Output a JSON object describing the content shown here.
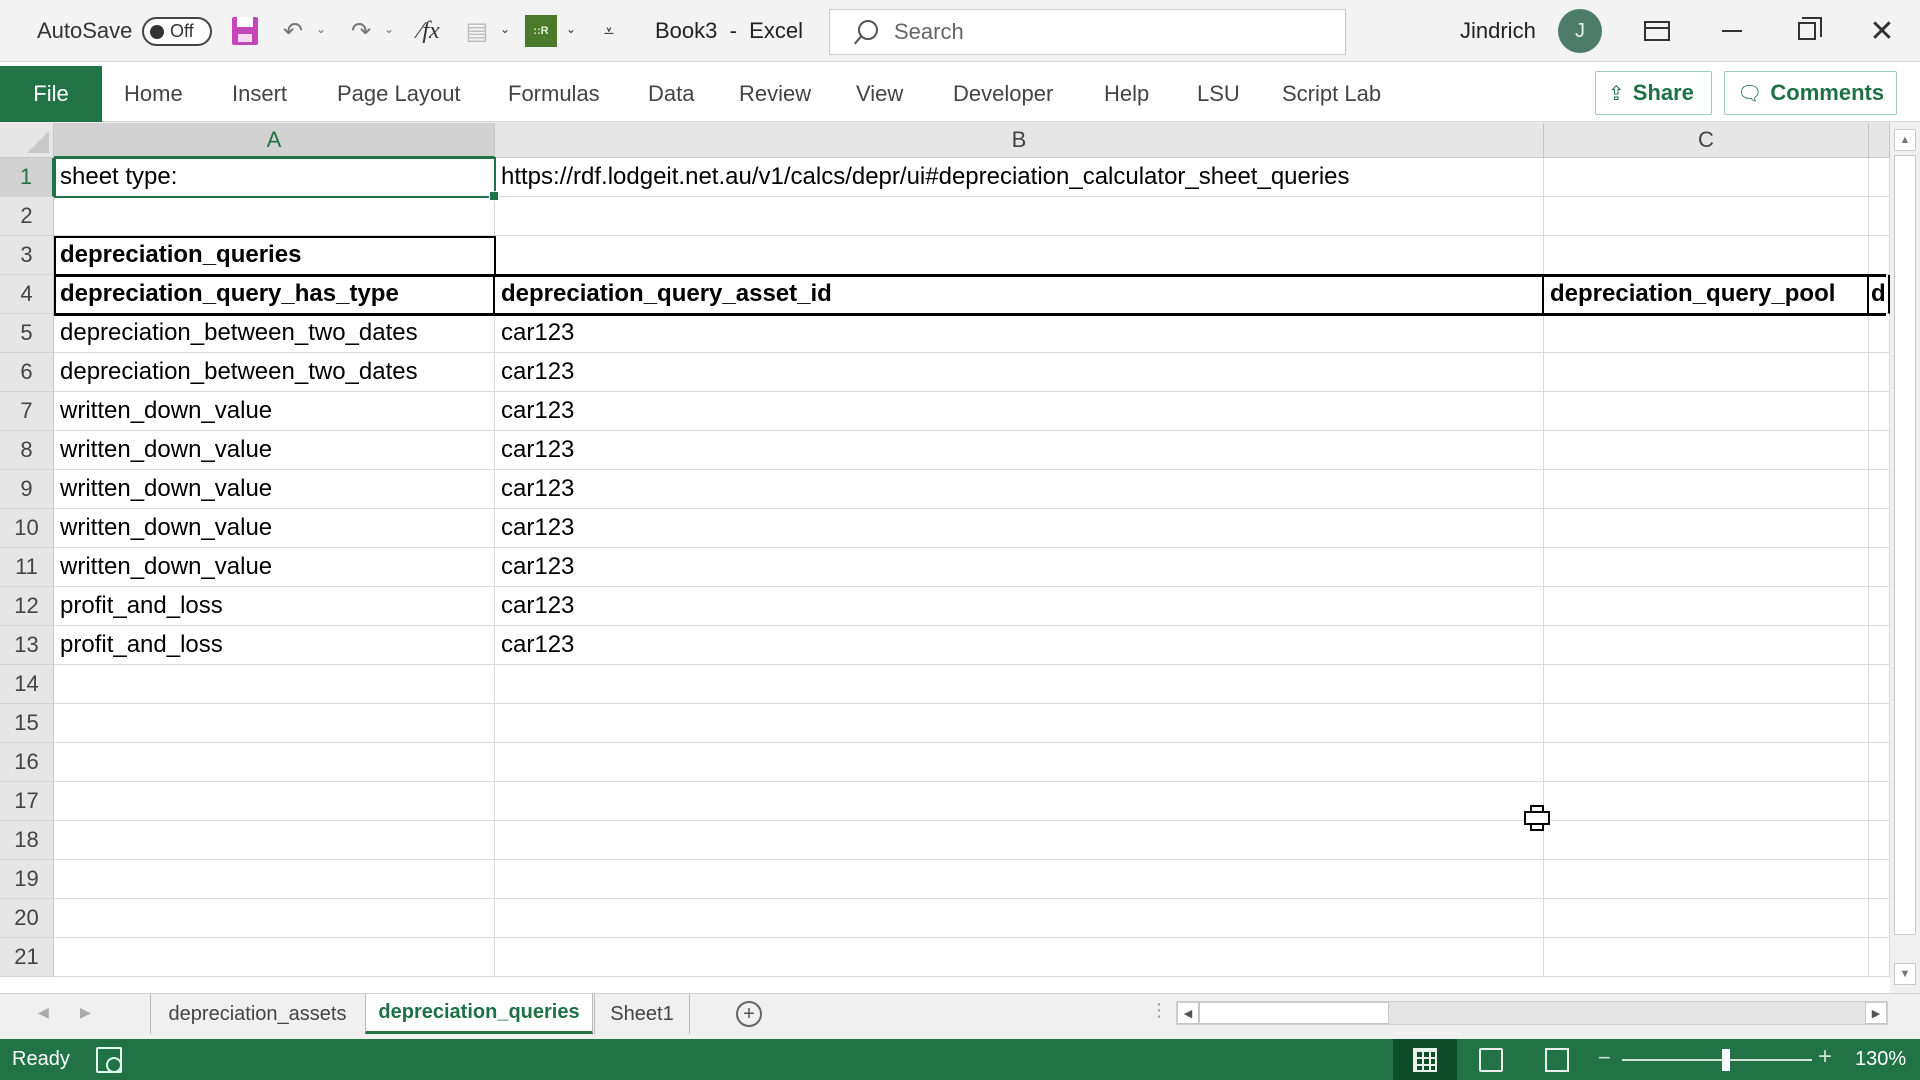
{
  "titlebar": {
    "autosave_label": "AutoSave",
    "autosave_state": "Off",
    "doc_title": "Book3  -  Excel",
    "search_placeholder": "Search",
    "user_name": "Jindrich",
    "avatar_initial": "J",
    "quick_access_icons": [
      "save-icon",
      "undo-icon",
      "redo-icon",
      "clear-formulas-icon",
      "paste-icon",
      "addin-icon",
      "customize-qat-icon"
    ]
  },
  "ribbon": {
    "file_label": "File",
    "tabs": [
      "Home",
      "Insert",
      "Page Layout",
      "Formulas",
      "Data",
      "Review",
      "View",
      "Developer",
      "Help",
      "LSU",
      "Script Lab"
    ],
    "share_label": "Share",
    "comments_label": "Comments"
  },
  "grid": {
    "columns": [
      "A",
      "B",
      "C"
    ],
    "active_column": "A",
    "active_row": 1,
    "row_numbers": [
      "1",
      "2",
      "3",
      "4",
      "5",
      "6",
      "7",
      "8",
      "9",
      "10",
      "11",
      "12",
      "13",
      "14",
      "15",
      "16",
      "17",
      "18",
      "19",
      "20",
      "21"
    ],
    "cells": {
      "A1": "sheet type:",
      "B1": "https://rdf.lodgeit.net.au/v1/calcs/depr/ui#depreciation_calculator_sheet_queries",
      "A3": "depreciation_queries",
      "A4": "depreciation_query_has_type",
      "B4": "depreciation_query_asset_id",
      "C4": "depreciation_query_pool",
      "D4": "d"
    },
    "rows": [
      {
        "row": 5,
        "type": "depreciation_between_two_dates",
        "asset_id": "car123"
      },
      {
        "row": 6,
        "type": "depreciation_between_two_dates",
        "asset_id": "car123"
      },
      {
        "row": 7,
        "type": "written_down_value",
        "asset_id": "car123"
      },
      {
        "row": 8,
        "type": "written_down_value",
        "asset_id": "car123"
      },
      {
        "row": 9,
        "type": "written_down_value",
        "asset_id": "car123"
      },
      {
        "row": 10,
        "type": "written_down_value",
        "asset_id": "car123"
      },
      {
        "row": 11,
        "type": "written_down_value",
        "asset_id": "car123"
      },
      {
        "row": 12,
        "type": "profit_and_loss",
        "asset_id": "car123"
      },
      {
        "row": 13,
        "type": "profit_and_loss",
        "asset_id": "car123"
      }
    ]
  },
  "sheets": {
    "tabs": [
      "depreciation_assets",
      "depreciation_queries",
      "Sheet1"
    ],
    "active": "depreciation_queries"
  },
  "statusbar": {
    "status": "Ready",
    "zoom_level": "130%",
    "zoom_percent": 130,
    "active_view": "normal"
  },
  "colors": {
    "accent": "#217346",
    "avatar": "#4e7c6b",
    "save_icon": "#c447ba"
  }
}
